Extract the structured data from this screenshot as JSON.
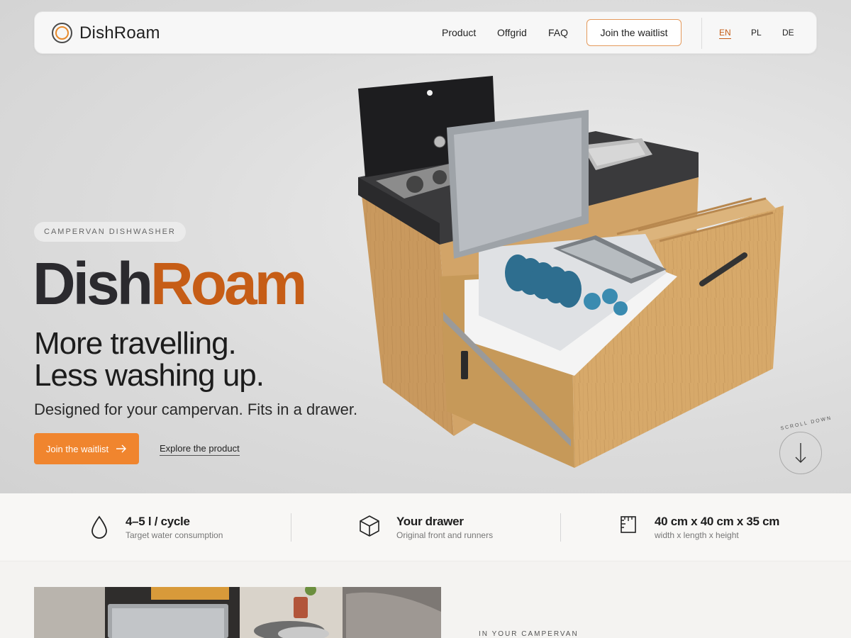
{
  "nav": {
    "logo_text": "DishRoam",
    "links": [
      "Product",
      "Offgrid",
      "FAQ"
    ],
    "cta": "Join the waitlist",
    "languages": [
      "EN",
      "PL",
      "DE"
    ],
    "active_language": "EN"
  },
  "hero": {
    "eyebrow": "CAMPERVAN DISHWASHER",
    "title_part1": "Dish",
    "title_part2": "Roam",
    "tagline_line1": "More travelling.",
    "tagline_line2": "Less washing up.",
    "subline": "Designed for your campervan. Fits in a drawer.",
    "primary_cta": "Join the waitlist",
    "secondary_cta": "Explore the product",
    "scroll_label": "SCROLL DOWN"
  },
  "specs": [
    {
      "icon": "water-drop-icon",
      "title": "4–5 l / cycle",
      "subtitle": "Target water consumption"
    },
    {
      "icon": "box-icon",
      "title": "Your drawer",
      "subtitle": "Original front and runners"
    },
    {
      "icon": "ruler-icon",
      "title": "40 cm x 40 cm x 35 cm",
      "subtitle": "width x length x height"
    }
  ],
  "section": {
    "eyebrow": "IN YOUR CAMPERVAN"
  },
  "colors": {
    "accent": "#f0852e",
    "brand_orange": "#c65d16",
    "dark": "#2b2a2e"
  }
}
